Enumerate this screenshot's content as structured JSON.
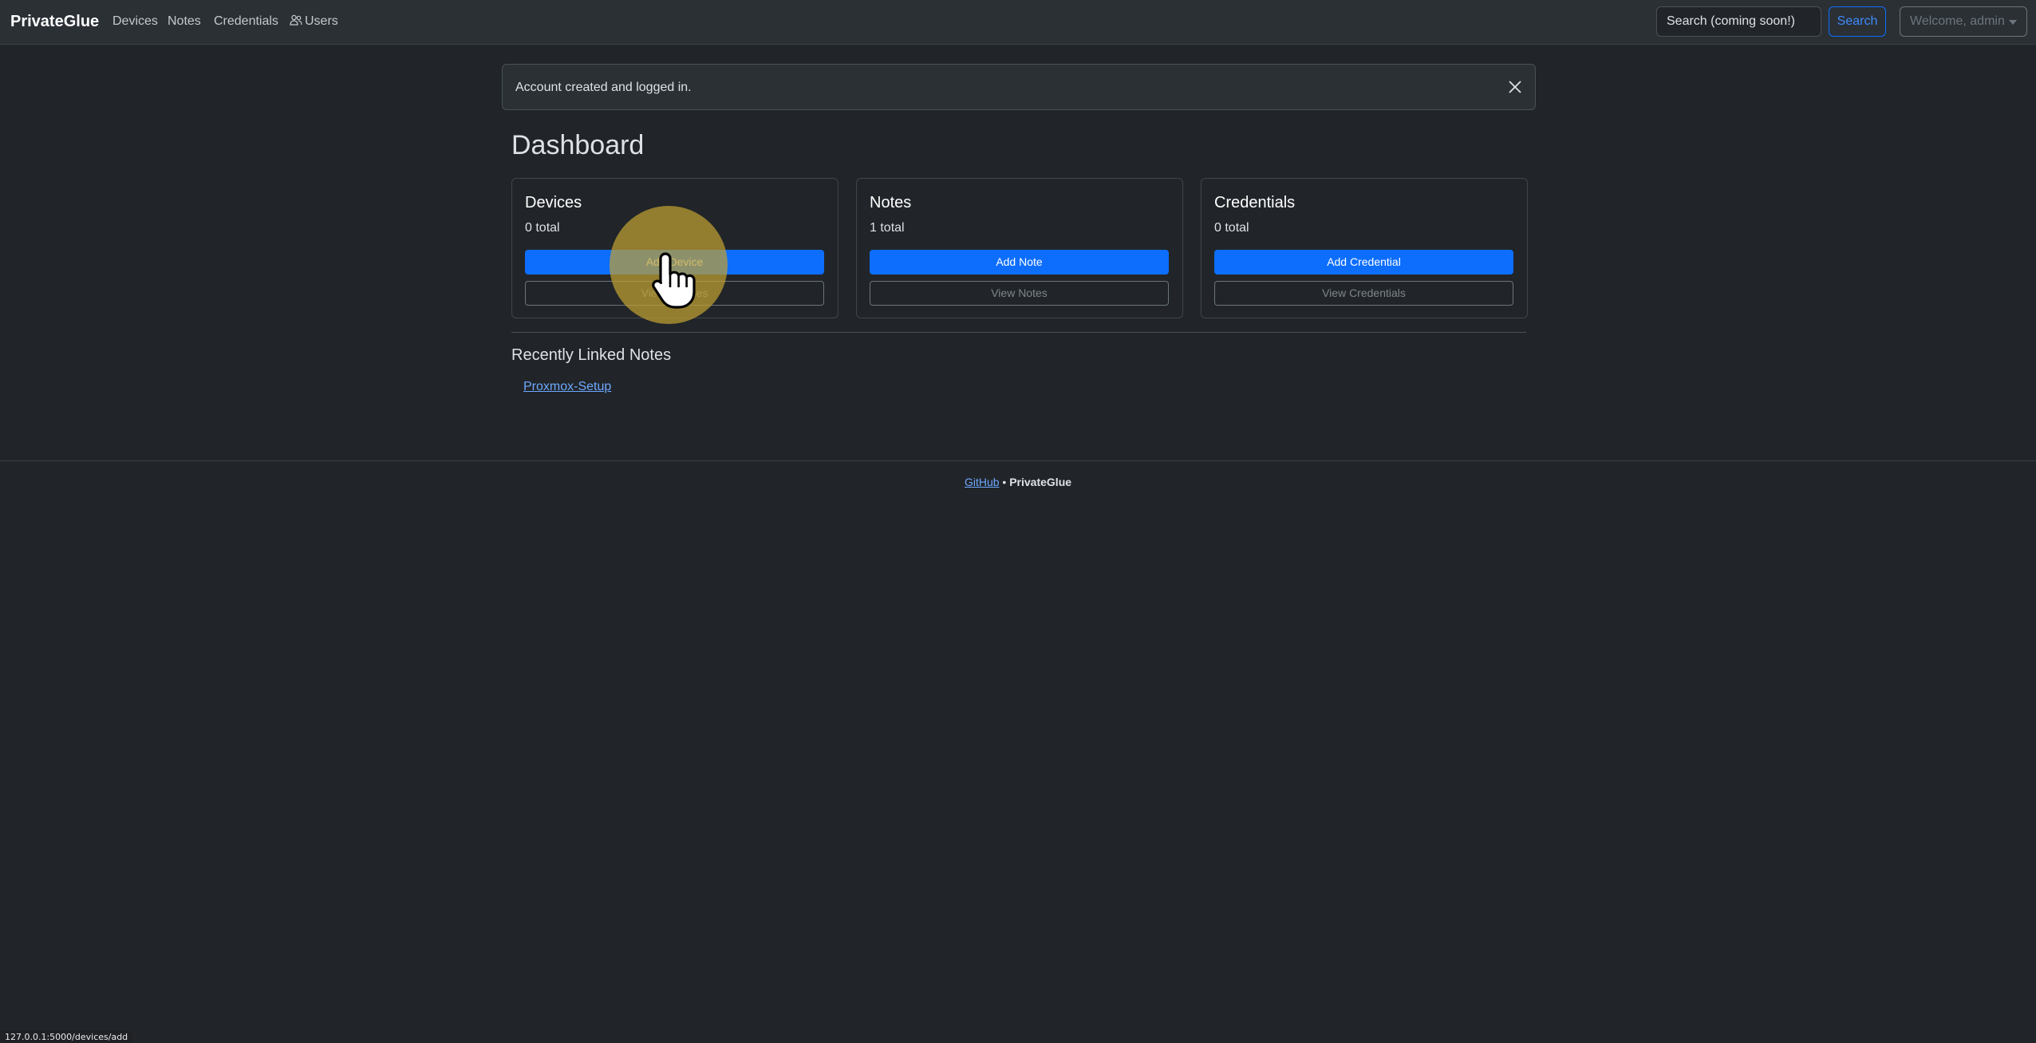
{
  "navbar": {
    "brand": "PrivateGlue",
    "links": [
      "Devices",
      "Notes",
      "Credentials",
      "Users"
    ],
    "search_value": "Search (coming soon!)",
    "search_button": "Search",
    "user_menu": "Welcome, admin"
  },
  "alert": {
    "message": "Account created and logged in."
  },
  "dashboard": {
    "title": "Dashboard",
    "cards": [
      {
        "title": "Devices",
        "count": "0 total",
        "add_label": "Add Device",
        "view_label": "View Devices"
      },
      {
        "title": "Notes",
        "count": "1 total",
        "add_label": "Add Note",
        "view_label": "View Notes"
      },
      {
        "title": "Credentials",
        "count": "0 total",
        "add_label": "Add Credential",
        "view_label": "View Credentials"
      }
    ],
    "recent_title": "Recently Linked Notes",
    "recent_notes": [
      "Proxmox-Setup"
    ]
  },
  "footer": {
    "link": "GitHub",
    "separator": "•",
    "name": "PrivateGlue"
  },
  "status_bar": {
    "url": "127.0.0.1:5000/devices/add"
  },
  "colors": {
    "background": "#212529",
    "primary": "#0d6efd",
    "link": "#6ea8fe",
    "click_highlight": "#bfa032"
  }
}
